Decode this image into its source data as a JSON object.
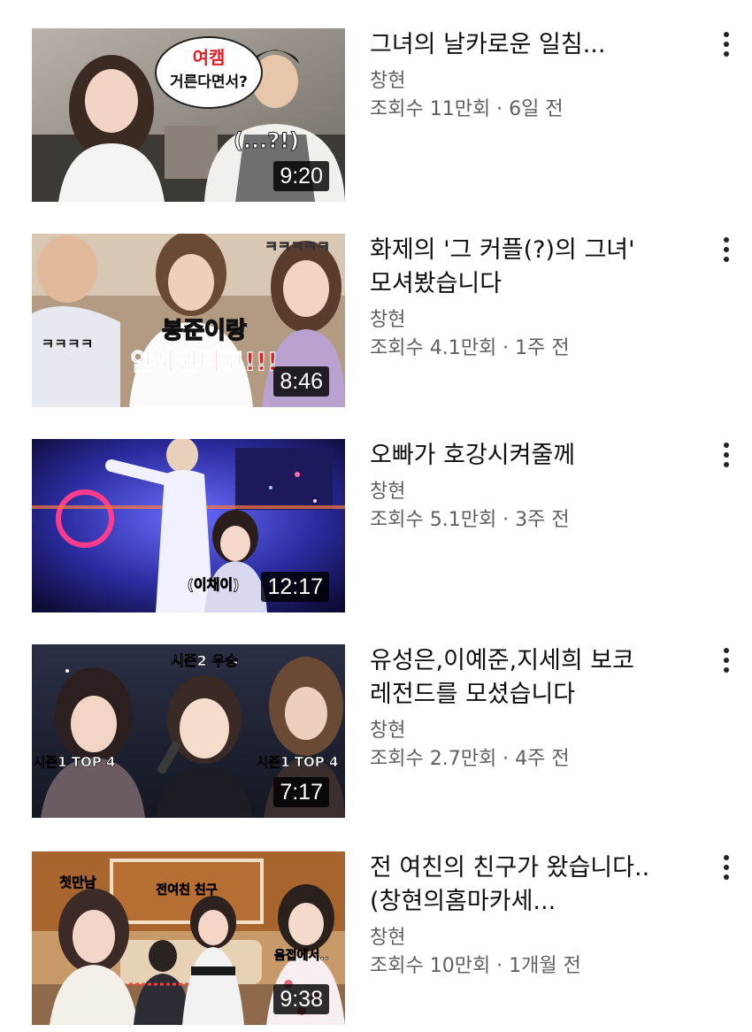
{
  "videos": [
    {
      "title": "그녀의 날카로운 일침...",
      "channel": "창현",
      "meta": "조회수 11만회 · 6일 전",
      "duration": "9:20",
      "thumb_text": [
        "여캠",
        "거른다면서?",
        "(...?!)"
      ]
    },
    {
      "title": "화제의 '그 커플(?)의 그녀'\n모셔봤습니다",
      "channel": "창현",
      "meta": "조회수 4.1만회 · 1주 전",
      "duration": "8:46",
      "thumb_text": [
        "ㅋㅋㅋㅋㅋ",
        "ㅋㅋㅋㅋ",
        "봉준이랑",
        "안사귄다고!!!"
      ]
    },
    {
      "title": "오빠가 호강시켜줄께",
      "channel": "창현",
      "meta": "조회수 5.1만회 · 3주 전",
      "duration": "12:17",
      "thumb_text": [
        "(이채이)"
      ]
    },
    {
      "title": "유성은,이예준,지세희 보코\n레전드를 모셨습니다",
      "channel": "창현",
      "meta": "조회수 2.7만회 · 4주 전",
      "duration": "7:17",
      "thumb_text": [
        "시즌2 우승",
        "시즌1 TOP 4",
        "시즌1 TOP 4"
      ]
    },
    {
      "title": "전 여친의 친구가 왔습니다..\n(창현의홈마카세...",
      "channel": "창현",
      "meta": "조회수 10만회 · 1개월 전",
      "duration": "9:38",
      "thumb_text": [
        "첫만남",
        "전여친 친구",
        "음접에서.."
      ]
    }
  ],
  "icons": {
    "more": "more-vert-icon"
  },
  "colors": {
    "title": "#0f0f0f",
    "secondary": "#606060",
    "duration_bg": "#000000"
  }
}
